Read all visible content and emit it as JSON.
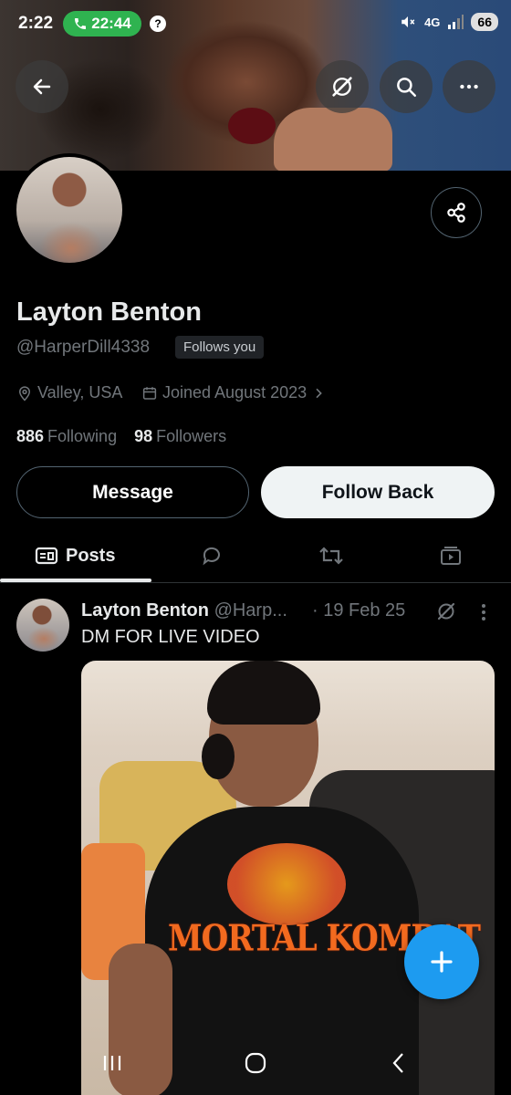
{
  "status_bar": {
    "time": "2:22",
    "call_duration": "22:44",
    "help_glyph": "?",
    "network": "4G",
    "battery": "66"
  },
  "header": {
    "back_icon": "arrow-left-icon",
    "grok_icon": "grok-icon",
    "search_icon": "search-icon",
    "more_icon": "more-horizontal-icon"
  },
  "profile": {
    "name": "Layton Benton",
    "handle": "@HarperDill4338",
    "follows_you": "Follows you",
    "location": "Valley, USA",
    "joined": "Joined August 2023",
    "following_count": "886",
    "following_label": "Following",
    "followers_count": "98",
    "followers_label": "Followers"
  },
  "actions": {
    "message": "Message",
    "follow_back": "Follow Back"
  },
  "tabs": [
    {
      "label": "Posts",
      "icon": "posts-icon",
      "active": true
    },
    {
      "label": "",
      "icon": "replies-icon"
    },
    {
      "label": "",
      "icon": "reposts-icon"
    },
    {
      "label": "",
      "icon": "media-icon"
    }
  ],
  "post": {
    "author": "Layton Benton",
    "handle": "@Harp...",
    "date": "· 19 Feb 25",
    "text": "DM FOR LIVE VIDEO",
    "image_text": "MORTAL KOMBAT"
  },
  "colors": {
    "accent": "#1d9bf0",
    "call_green": "#2fb350",
    "background": "#000000",
    "muted_text": "#71767b"
  }
}
